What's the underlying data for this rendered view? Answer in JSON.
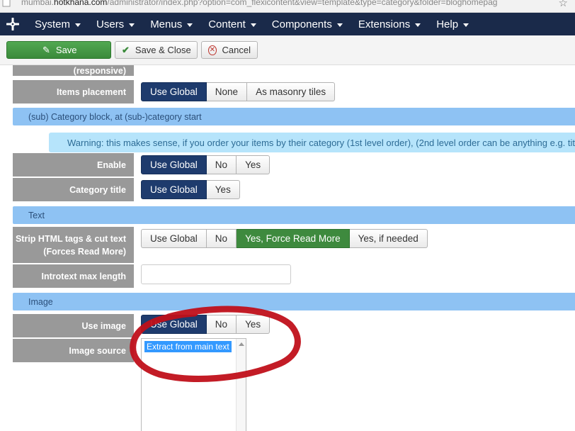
{
  "browser": {
    "url_prefix": "mumbai.",
    "url_domain": "hotkhana.com",
    "url_rest": "/administrator/index.php?option=com_flexicontent&view=template&type=category&folder=bloghomepag"
  },
  "menubar": {
    "items": [
      "System",
      "Users",
      "Menus",
      "Content",
      "Components",
      "Extensions",
      "Help"
    ]
  },
  "toolbar": {
    "save_label": "Save",
    "save_close_label": "Save & Close",
    "cancel_label": "Cancel"
  },
  "form": {
    "partial_label": "(responsive)",
    "items_placement": {
      "label": "Items placement",
      "options": [
        "Use Global",
        "None",
        "As masonry tiles"
      ],
      "selected": "Use Global"
    },
    "section_subcategory": "(sub) Category block, at (sub-)category start",
    "warning": "Warning: this makes sense, if you order your items by their category (1st level order), (2nd level order can be anything e.g. tit",
    "enable": {
      "label": "Enable",
      "options": [
        "Use Global",
        "No",
        "Yes"
      ],
      "selected": "Use Global"
    },
    "category_title": {
      "label": "Category title",
      "options": [
        "Use Global",
        "Yes"
      ],
      "selected": "Use Global"
    },
    "section_text": "Text",
    "strip_html": {
      "label_line1": "Strip HTML tags & cut text",
      "label_line2": "(Forces Read More)",
      "options": [
        "Use Global",
        "No",
        "Yes, Force Read More",
        "Yes, if needed"
      ],
      "selected": "Yes, Force Read More"
    },
    "introtext_max_length": {
      "label": "Introtext max length",
      "value": ""
    },
    "section_image": "Image",
    "use_image": {
      "label": "Use image",
      "options": [
        "Use Global",
        "No",
        "Yes"
      ],
      "selected": "Use Global"
    },
    "image_source": {
      "label": "Image source",
      "options": [
        "Extract from main text"
      ],
      "selected": "Extract from main text"
    }
  },
  "colors": {
    "menubar": "#1a2a4a",
    "active_blue": "#1e3b6d",
    "active_green": "#3e8a3e",
    "section": "#8ec2f3",
    "warning": "#b6e4fb",
    "annotation": "#c0101a"
  }
}
